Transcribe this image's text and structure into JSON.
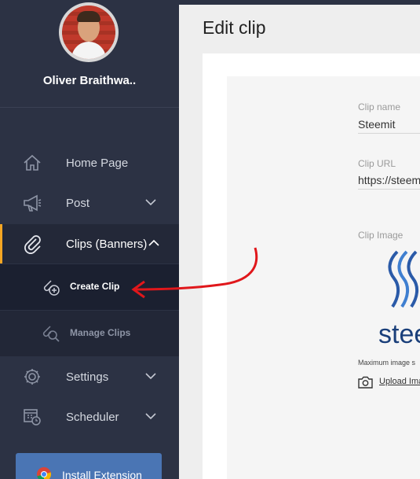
{
  "user": {
    "name": "Oliver Braithwa.."
  },
  "sidebar": {
    "items": [
      {
        "label": "Home Page",
        "icon": "home-icon"
      },
      {
        "label": "Post",
        "icon": "megaphone-icon"
      },
      {
        "label": "Clips (Banners)",
        "icon": "paperclip-icon"
      },
      {
        "label": "Settings",
        "icon": "gear-icon"
      },
      {
        "label": "Scheduler",
        "icon": "calendar-clock-icon"
      }
    ],
    "sub_items": [
      {
        "label": "Create Clip",
        "icon": "add-clip-icon"
      },
      {
        "label": "Manage Clips",
        "icon": "search-clip-icon"
      }
    ],
    "install_label": "Install Extension",
    "accent_color": "#f5a623"
  },
  "main": {
    "title": "Edit clip",
    "fields": {
      "clip_name_label": "Clip name",
      "clip_name_value": "Steemit",
      "clip_url_label": "Clip URL",
      "clip_url_value": "https://steem",
      "clip_image_label": "Clip Image",
      "max_image_note": "Maximum image s",
      "upload_label": "Upload Ima"
    },
    "logo_text": "steem"
  }
}
